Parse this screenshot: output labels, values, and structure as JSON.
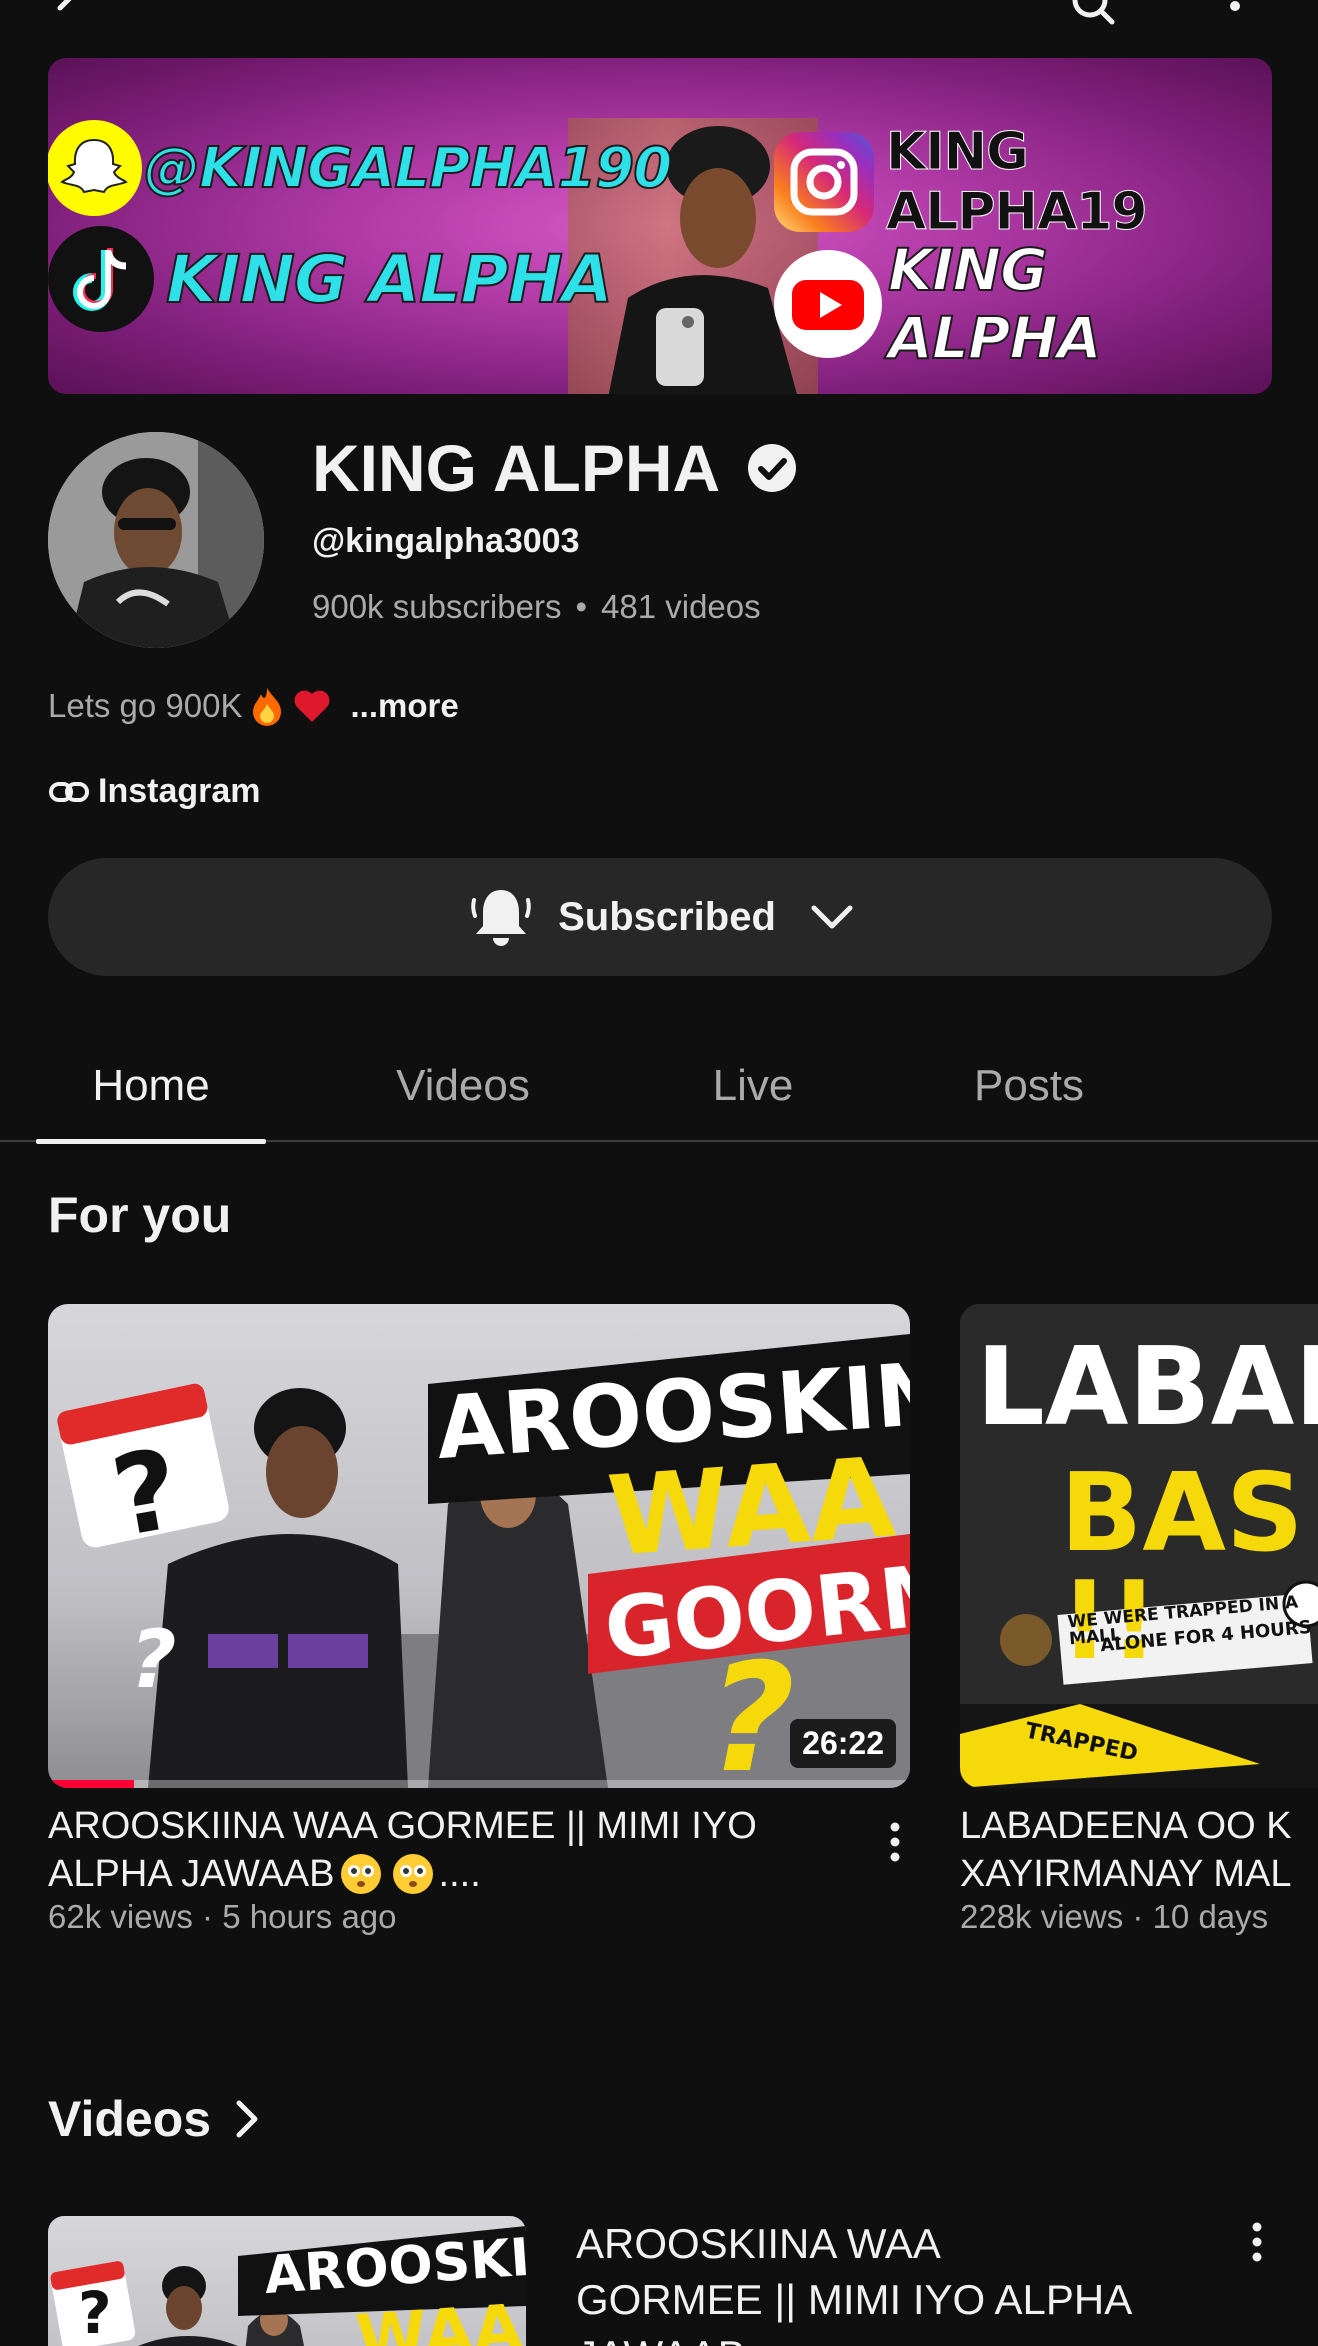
{
  "topbar": {
    "back_icon": "chevron-left-icon",
    "search_icon": "search-icon",
    "menu_icon": "more-vertical-icon"
  },
  "banner": {
    "snapchat": "@KINGALPHA190",
    "tiktok": "KING ALPHA",
    "instagram": "KING ALPHA19",
    "youtube": "KING ALPHA"
  },
  "channel": {
    "name": "KING ALPHA",
    "verified": true,
    "handle": "@kingalpha3003",
    "subscribers": "900k subscribers",
    "videos": "481 videos",
    "description": "Lets go 900K",
    "more": "...more",
    "link_label": "Instagram"
  },
  "subscribe": {
    "label": "Subscribed"
  },
  "tabs": [
    {
      "label": "Home",
      "active": true
    },
    {
      "label": "Videos",
      "active": false
    },
    {
      "label": "Live",
      "active": false
    },
    {
      "label": "Posts",
      "active": false
    }
  ],
  "for_you": {
    "title": "For you",
    "items": [
      {
        "thumb_text": [
          "AROOSKINA",
          "WAA",
          "GOORME",
          "?"
        ],
        "duration": "26:22",
        "progress": 0.1,
        "title_line1": "AROOSKIINA WAA GORMEE || MIMI IYO",
        "title_line2": "ALPHA JAWAAB",
        "title_suffix": "....",
        "meta": "62k views · 5 hours ago"
      },
      {
        "thumb_text": [
          "LABADEE",
          "BAS !!",
          "WE WERE TRAPPED IN A MALL",
          "ALONE FOR 4 HOURS",
          "TRAPPED"
        ],
        "title_line1": "LABADEENA OO K",
        "title_line2": "XAYIRMANAY MAL",
        "meta": "228k views · 10 days"
      }
    ]
  },
  "videos_section": {
    "title": "Videos",
    "first": {
      "thumb_text": [
        "AROOSKINA",
        "WAA"
      ],
      "title_line1": "AROOSKIINA WAA",
      "title_line2": "GORMEE || MIMI IYO ALPHA",
      "title_line3": "JAWAAB"
    }
  },
  "colors": {
    "background": "#0f0f0f",
    "text": "#f1f1f1",
    "secondary": "#aaaaaa",
    "button": "#272727",
    "progress": "#ff0033",
    "thumb_yellow": "#f5d90a"
  }
}
